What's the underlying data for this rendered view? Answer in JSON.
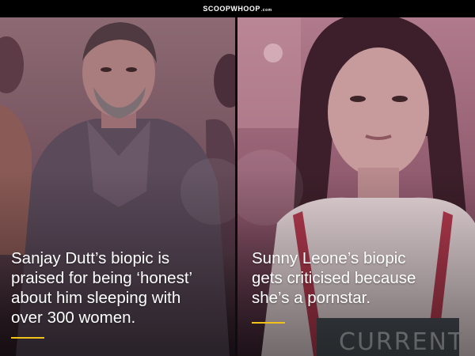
{
  "header": {
    "brand": "SCOOPWHOOP",
    "brand_suffix": ".com"
  },
  "left_panel": {
    "caption": "Sanjay Dutt’s biopic is\npraised for being ‘honest’\nabout him sleeping with\nover 300 women.",
    "tint_color": "#7a4a5c"
  },
  "right_panel": {
    "caption": "Sunny Leone’s biopic\ngets criticised because\nshe’s a pornstar.",
    "tint_color": "#8a4e62"
  },
  "colors": {
    "accent_rule": "#f2c21b",
    "background": "#000000",
    "text": "#ffffff"
  }
}
